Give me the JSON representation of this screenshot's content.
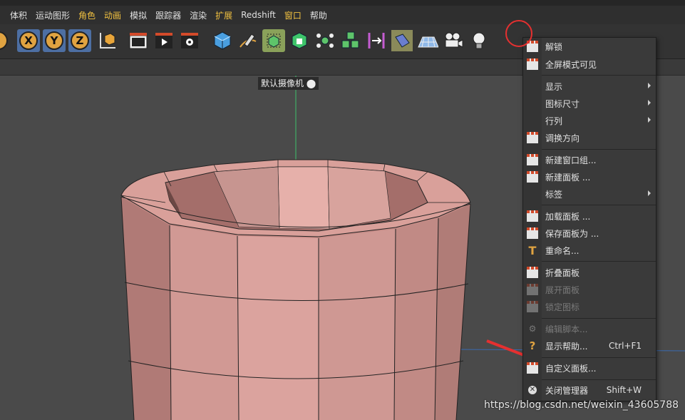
{
  "menubar": {
    "items": [
      {
        "label": "体积",
        "highlight": false
      },
      {
        "label": "运动图形",
        "highlight": false
      },
      {
        "label": "角色",
        "highlight": true
      },
      {
        "label": "动画",
        "highlight": true
      },
      {
        "label": "模拟",
        "highlight": false
      },
      {
        "label": "跟踪器",
        "highlight": false
      },
      {
        "label": "渲染",
        "highlight": false
      },
      {
        "label": "扩展",
        "highlight": true
      },
      {
        "label": "Redshift",
        "highlight": false
      },
      {
        "label": "窗口",
        "highlight": true
      },
      {
        "label": "帮助",
        "highlight": false
      }
    ]
  },
  "toolbar": {
    "axis_x": "X",
    "axis_y": "Y",
    "axis_z": "Z"
  },
  "viewport": {
    "camera_label": "默认摄像机"
  },
  "context_menu": {
    "items": [
      {
        "label": "解锁",
        "shortcut": "",
        "submenu": false,
        "disabled": false,
        "icon": "unlock-icon"
      },
      {
        "label": "全屏模式可见",
        "shortcut": "",
        "submenu": false,
        "disabled": false,
        "icon": "fullscreen-icon"
      },
      {
        "label": "显示",
        "shortcut": "",
        "submenu": true,
        "disabled": false,
        "icon": ""
      },
      {
        "label": "图标尺寸",
        "shortcut": "",
        "submenu": true,
        "disabled": false,
        "icon": ""
      },
      {
        "label": "行列",
        "shortcut": "",
        "submenu": true,
        "disabled": false,
        "icon": ""
      },
      {
        "label": "调换方向",
        "shortcut": "",
        "submenu": false,
        "disabled": false,
        "icon": "swap-direction-icon"
      },
      {
        "label": "新建窗口组...",
        "shortcut": "",
        "submenu": false,
        "disabled": false,
        "icon": "new-window-group-icon"
      },
      {
        "label": "新建面板 ...",
        "shortcut": "",
        "submenu": false,
        "disabled": false,
        "icon": "new-palette-icon"
      },
      {
        "label": "标签",
        "shortcut": "",
        "submenu": true,
        "disabled": false,
        "icon": ""
      },
      {
        "label": "加载面板 ...",
        "shortcut": "",
        "submenu": false,
        "disabled": false,
        "icon": "load-palette-icon"
      },
      {
        "label": "保存面板为 ...",
        "shortcut": "",
        "submenu": false,
        "disabled": false,
        "icon": "save-palette-icon"
      },
      {
        "label": "重命名...",
        "shortcut": "",
        "submenu": false,
        "disabled": false,
        "icon": "rename-icon"
      },
      {
        "label": "折叠面板",
        "shortcut": "",
        "submenu": false,
        "disabled": false,
        "icon": "fold-palette-icon"
      },
      {
        "label": "展开面板",
        "shortcut": "",
        "submenu": false,
        "disabled": true,
        "icon": "unfold-palette-icon"
      },
      {
        "label": "锁定图标",
        "shortcut": "",
        "submenu": false,
        "disabled": true,
        "icon": "lock-icons-icon"
      },
      {
        "label": "编辑脚本...",
        "shortcut": "",
        "submenu": false,
        "disabled": true,
        "icon": "edit-script-icon"
      },
      {
        "label": "显示帮助...",
        "shortcut": "Ctrl+F1",
        "submenu": false,
        "disabled": false,
        "icon": "help-icon"
      },
      {
        "label": "自定义面板...",
        "shortcut": "",
        "submenu": false,
        "disabled": false,
        "icon": "customize-palettes-icon"
      },
      {
        "label": "关闭管理器",
        "shortcut": "Shift+W",
        "submenu": false,
        "disabled": false,
        "icon": "close-manager-icon"
      }
    ]
  },
  "watermark": "https://blog.csdn.net/weixin_43605788",
  "colors": {
    "accent_menu": "#f0c040",
    "annotation_red": "#e53030",
    "object_pink": "#c98b86"
  }
}
